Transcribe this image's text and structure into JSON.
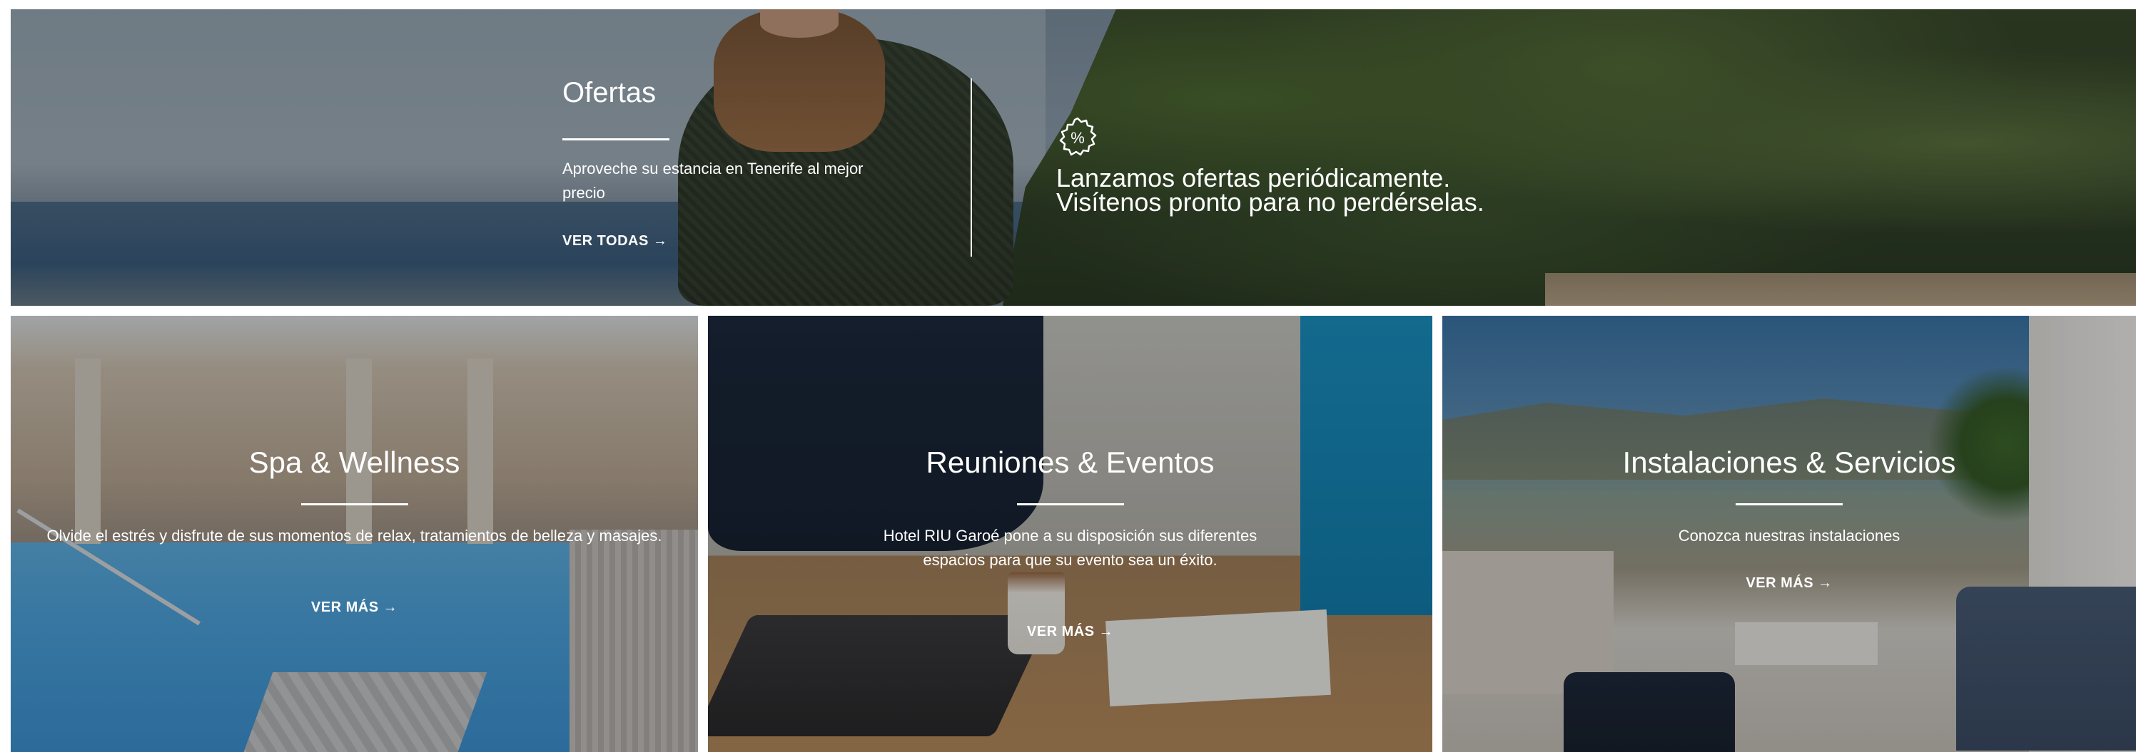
{
  "offers": {
    "title": "Ofertas",
    "description": "Aproveche su estancia en Tenerife al mejor precio",
    "link_label": "VER TODAS →",
    "badge_icon": "percent-badge-icon",
    "badge_symbol": "%",
    "message_line1": "Lanzamos ofertas periódicamente.",
    "message_line2": "Visítenos pronto para no perdérselas."
  },
  "cards": [
    {
      "title": "Spa & Wellness",
      "description": "Olvide el estrés y disfrute de sus momentos de relax, tratamientos de belleza y masajes.",
      "link_label": "VER MÁS →"
    },
    {
      "title": "Reuniones & Eventos",
      "description": "Hotel RIU Garoé pone a su disposición sus diferentes espacios para que su evento sea un éxito.",
      "link_label": "VER MÁS →"
    },
    {
      "title": "Instalaciones & Servicios",
      "description": "Conozca nuestras instalaciones",
      "link_label": "VER MÁS →"
    }
  ],
  "colors": {
    "text": "#ffffff",
    "page_background": "#ffffff"
  }
}
